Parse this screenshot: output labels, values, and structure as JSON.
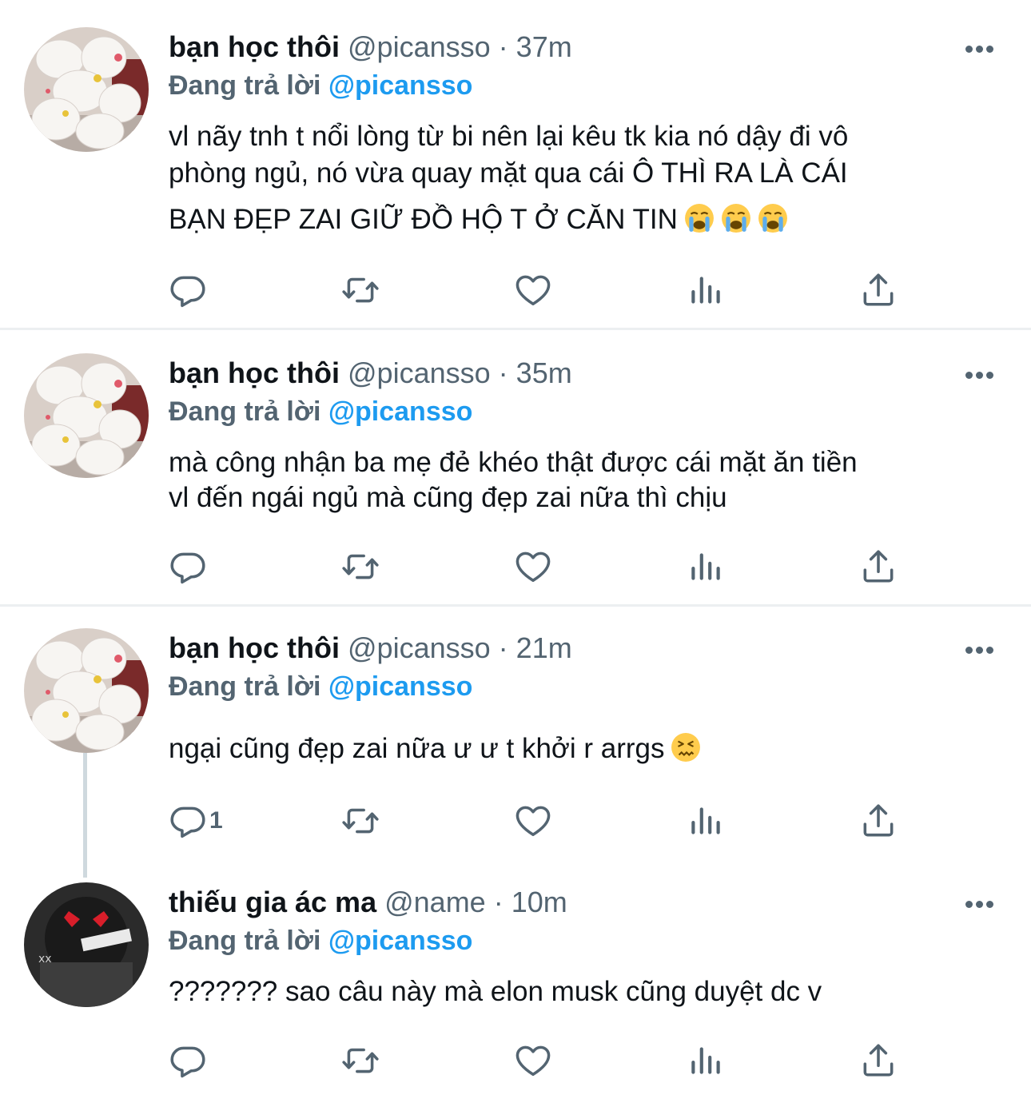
{
  "tweets": [
    {
      "name": "bạn học thôi",
      "handle": "@picansso",
      "dot": "·",
      "time": "37m",
      "replying_prefix": "Đang trả lời",
      "replying_to": "@picansso",
      "lines": [
        "vl nãy tnh t nổi lòng từ bi nên lại kêu tk kia nó dậy đi vô",
        "phòng ngủ, nó vừa quay mặt qua cái Ô THÌ RA LÀ CÁI",
        "BẠN ĐẸP ZAI GIỮ ĐỒ HỘ T Ở CĂN TIN"
      ],
      "emoji": [
        "loudly-crying-face",
        "loudly-crying-face",
        "loudly-crying-face"
      ],
      "reply_count": ""
    },
    {
      "name": "bạn học thôi",
      "handle": "@picansso",
      "dot": "·",
      "time": "35m",
      "replying_prefix": "Đang trả lời",
      "replying_to": "@picansso",
      "lines": [
        "mà công nhận ba mẹ đẻ khéo thật được cái mặt ăn tiền",
        "vl đến ngái ngủ mà cũng đẹp zai nữa thì chịu"
      ],
      "reply_count": ""
    },
    {
      "name": "bạn học thôi",
      "handle": "@picansso",
      "dot": "·",
      "time": "21m",
      "replying_prefix": "Đang trả lời",
      "replying_to": "@picansso",
      "lines": [
        "ngại cũng đẹp zai nữa ư ư t khởi r arrgs"
      ],
      "emoji": [
        "confounded-face"
      ],
      "reply_count": "1"
    },
    {
      "name": "thiếu gia ác ma",
      "handle": "@name",
      "dot": "·",
      "time": "10m",
      "replying_prefix": "Đang trả lời",
      "replying_to": "@picansso",
      "lines": [
        "??????? sao câu này mà elon musk cũng duyệt dc v"
      ],
      "reply_count": ""
    }
  ],
  "colors": {
    "text": "#0f1419",
    "secondary": "#536471",
    "mention": "#1d9bf0",
    "divider": "#eceff1"
  },
  "icons": [
    "reply-icon",
    "retweet-icon",
    "like-icon",
    "views-icon",
    "share-icon",
    "more-icon"
  ]
}
